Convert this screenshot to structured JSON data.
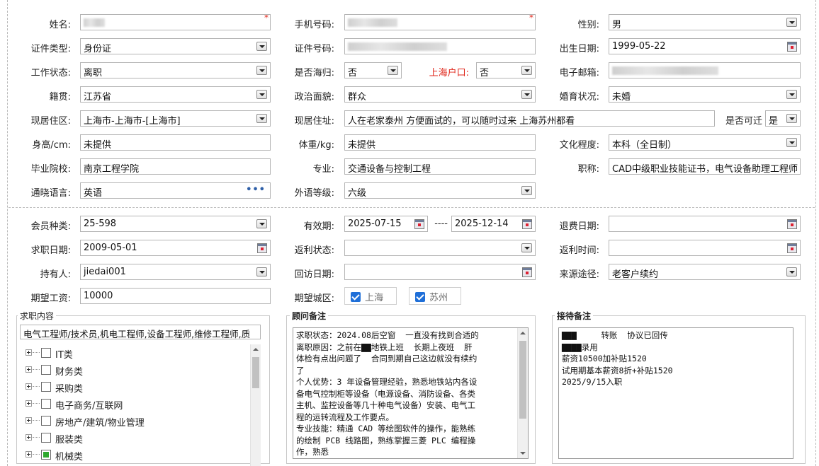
{
  "form": {
    "name": {
      "label": "姓名:"
    },
    "mobile": {
      "label": "手机号码:"
    },
    "gender": {
      "label": "性别:",
      "value": "男"
    },
    "id_type": {
      "label": "证件类型:",
      "value": "身份证"
    },
    "id_number": {
      "label": "证件号码:"
    },
    "birth_date": {
      "label": "出生日期:",
      "value": "1999-05-22"
    },
    "work_status": {
      "label": "工作状态:",
      "value": "离职"
    },
    "returnee": {
      "label": "是否海归:",
      "value": "否"
    },
    "shanghai_hukou": {
      "label": "上海户口:",
      "value": "否"
    },
    "email": {
      "label": "电子邮箱:"
    },
    "native_place": {
      "label": "籍贯:",
      "value": "江苏省"
    },
    "political": {
      "label": "政治面貌:",
      "value": "群众"
    },
    "marital": {
      "label": "婚育状况:",
      "value": "未婚"
    },
    "residence_area": {
      "label": "现居住区:",
      "value": "上海市-上海市-[上海市]"
    },
    "residence_address": {
      "label": "现居住址:",
      "value": "人在老家泰州 方便面试的，可以随时过来 上海苏州都看"
    },
    "relocate": {
      "label": "是否可迁",
      "value": "是"
    },
    "height": {
      "label": "身高/cm:",
      "value": "未提供"
    },
    "weight": {
      "label": "体重/kg:",
      "value": "未提供"
    },
    "education": {
      "label": "文化程度:",
      "value": "本科（全日制）"
    },
    "school": {
      "label": "毕业院校:",
      "value": "南京工程学院"
    },
    "major": {
      "label": "专业:",
      "value": "交通设备与控制工程"
    },
    "title": {
      "label": "职称:",
      "value": "CAD中级职业技能证书，电气设备助理工程师"
    },
    "language": {
      "label": "通晓语言:",
      "value": "英语"
    },
    "language_level": {
      "label": "外语等级:",
      "value": "六级"
    },
    "member_type": {
      "label": "会员种类:",
      "value": "25-598"
    },
    "valid_period": {
      "label": "有效期:",
      "start": "2025-07-15",
      "sep": "----",
      "end": "2025-12-14"
    },
    "refund_date": {
      "label": "退费日期:",
      "value": ""
    },
    "job_seek_date": {
      "label": "求职日期:",
      "value": "2009-05-01"
    },
    "rebate_status": {
      "label": "返利状态:",
      "value": ""
    },
    "rebate_time": {
      "label": "返利时间:",
      "value": ""
    },
    "holder": {
      "label": "持有人:",
      "value": "jiedai001"
    },
    "followup_date": {
      "label": "回访日期:",
      "value": ""
    },
    "source": {
      "label": "来源途径:",
      "value": "老客户续约"
    },
    "expected_salary": {
      "label": "期望工资:",
      "value": "10000"
    },
    "expected_city": {
      "label": "期望城区:",
      "options": [
        "上海",
        "苏州"
      ]
    }
  },
  "job_panel": {
    "title": "求职内容",
    "summary": "电气工程师/技术员,机电工程师,设备工程师,维修工程师,质",
    "tree": [
      "IT类",
      "财务类",
      "采购类",
      "电子商务/互联网",
      "房地产/建筑/物业管理",
      "服装类",
      "机械类"
    ]
  },
  "advisor_panel": {
    "title": "顾问备注",
    "lines": [
      "求职状态：2024.08后空窗  一直没有找到合适的",
      "离职原因：之前在▇▇地铁上班  长期上夜班  肝",
      "体检有点出问题了  合同到期自己这边就没有续约",
      "了",
      "个人优势：3 年设备管理经验，熟悉地铁站内各设",
      "备电气控制柜等设备（电源设备、消防设备、各类",
      "主机、监控设备等几十种电气设备）安装、电气工",
      "程的运转流程及工作要点。",
      "专业技能：精通 CAD 等绘图软件的操作，能熟练",
      "的绘制 PCB 线路图，熟练掌握三菱 PLC 编程操",
      "作，熟悉"
    ]
  },
  "reception_panel": {
    "title": "接待备注",
    "lines": [
      "▇▇▇     转账  协议已回传",
      "",
      "▇▇▇▇录用",
      "薪资10500加补贴1520",
      "试用期基本薪资8折+补贴1520",
      "2025/9/15入职"
    ]
  },
  "colors": {
    "required": "#e0271b",
    "checkbox": "#1f6fd8",
    "tree_partial": "#2ea82e"
  }
}
